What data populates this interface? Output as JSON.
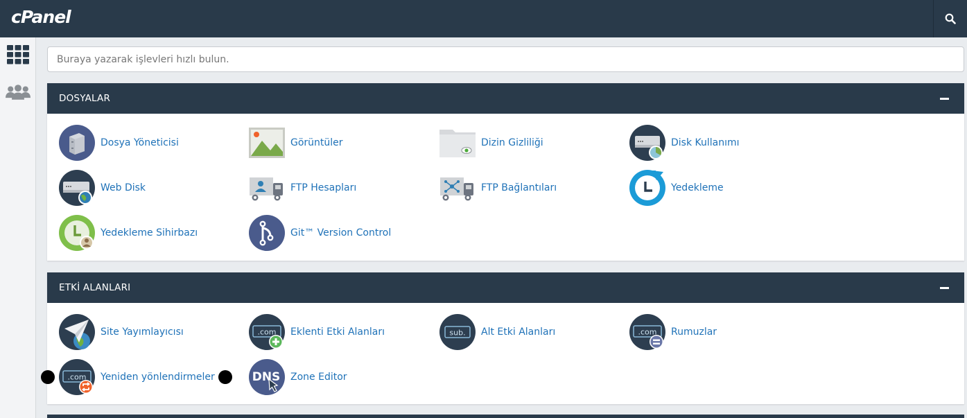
{
  "app": {
    "logo_text": "cPanel"
  },
  "sidebar": {
    "items": [
      {
        "icon": "grid-icon",
        "name": "home"
      },
      {
        "icon": "users-icon",
        "name": "users"
      }
    ]
  },
  "search": {
    "placeholder": "Buraya yazarak işlevleri hızlı bulun.",
    "value": ""
  },
  "sections": [
    {
      "title": "DOSYALAR",
      "items": [
        {
          "label": "Dosya Yöneticisi",
          "icon": "file-manager-icon"
        },
        {
          "label": "Görüntüler",
          "icon": "images-icon"
        },
        {
          "label": "Dizin Gizliliği",
          "icon": "directory-privacy-icon"
        },
        {
          "label": "Disk Kullanımı",
          "icon": "disk-usage-icon"
        },
        {
          "label": "Web Disk",
          "icon": "web-disk-icon"
        },
        {
          "label": "FTP Hesapları",
          "icon": "ftp-accounts-icon"
        },
        {
          "label": "FTP Bağlantıları",
          "icon": "ftp-connections-icon"
        },
        {
          "label": "Yedekleme",
          "icon": "backup-icon"
        },
        {
          "label": "Yedekleme Sihirbazı",
          "icon": "backup-wizard-icon"
        },
        {
          "label": "Git™ Version Control",
          "icon": "git-icon"
        }
      ]
    },
    {
      "title": "ETKİ ALANLARI",
      "items": [
        {
          "label": "Site Yayımlayıcısı",
          "icon": "site-publisher-icon"
        },
        {
          "label": "Eklenti Etki Alanları",
          "icon": "addon-domains-icon"
        },
        {
          "label": "Alt Etki Alanları",
          "icon": "subdomains-icon"
        },
        {
          "label": "Rumuzlar",
          "icon": "aliases-icon"
        },
        {
          "label": "Yeniden yönlendirmeler",
          "icon": "redirects-icon"
        },
        {
          "label": "Zone Editor",
          "icon": "zone-editor-icon"
        }
      ]
    }
  ],
  "icon_text": {
    "com": ".com",
    "sub": "sub.",
    "dns": "DNS"
  },
  "colors": {
    "header": "#293a4a",
    "link": "#1f72b8",
    "accent_blue": "#1b9bd7",
    "accent_green": "#5cb85c",
    "accent_orange": "#f0622b"
  }
}
